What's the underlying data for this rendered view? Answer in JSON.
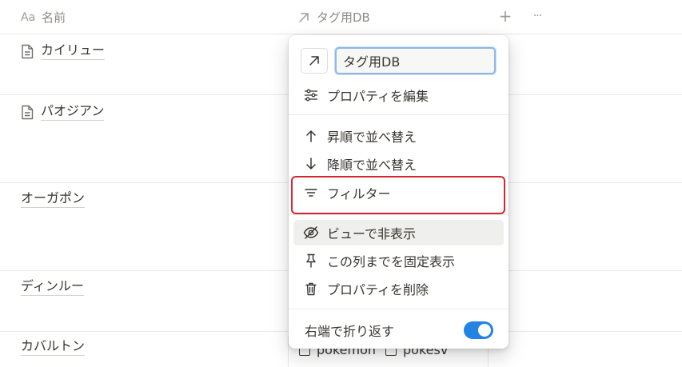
{
  "header": {
    "name_icon": "Aa",
    "name_label": "名前",
    "tag_label": "タグ用DB",
    "add_glyph": "+",
    "more_glyph": "···"
  },
  "rows": [
    {
      "title": "カイリュー",
      "has_doc_icon": true
    },
    {
      "title": "パオジアン",
      "has_doc_icon": true
    },
    {
      "title": "オーガポン",
      "has_doc_icon": false
    },
    {
      "title": "ディンルー",
      "has_doc_icon": false
    },
    {
      "title": "カバルトン",
      "has_doc_icon": false
    }
  ],
  "bottom_tags": [
    "pokemon",
    "pokesv"
  ],
  "menu": {
    "name_value": "タグ用DB",
    "name_icon": "arrow-up-right-icon",
    "edit_property": "プロパティを編集",
    "sort_asc": "昇順で並べ替え",
    "sort_desc": "降順で並べ替え",
    "filter": "フィルター",
    "hide_in_view": "ビューで非表示",
    "freeze_column": "この列までを固定表示",
    "delete_property": "プロパティを削除",
    "wrap_text": "右端で折り返す",
    "wrap_enabled": true
  },
  "colors": {
    "accent": "#2383e2",
    "highlight_box": "#d9262c",
    "text": "#37352f",
    "muted": "#8d8b87"
  }
}
